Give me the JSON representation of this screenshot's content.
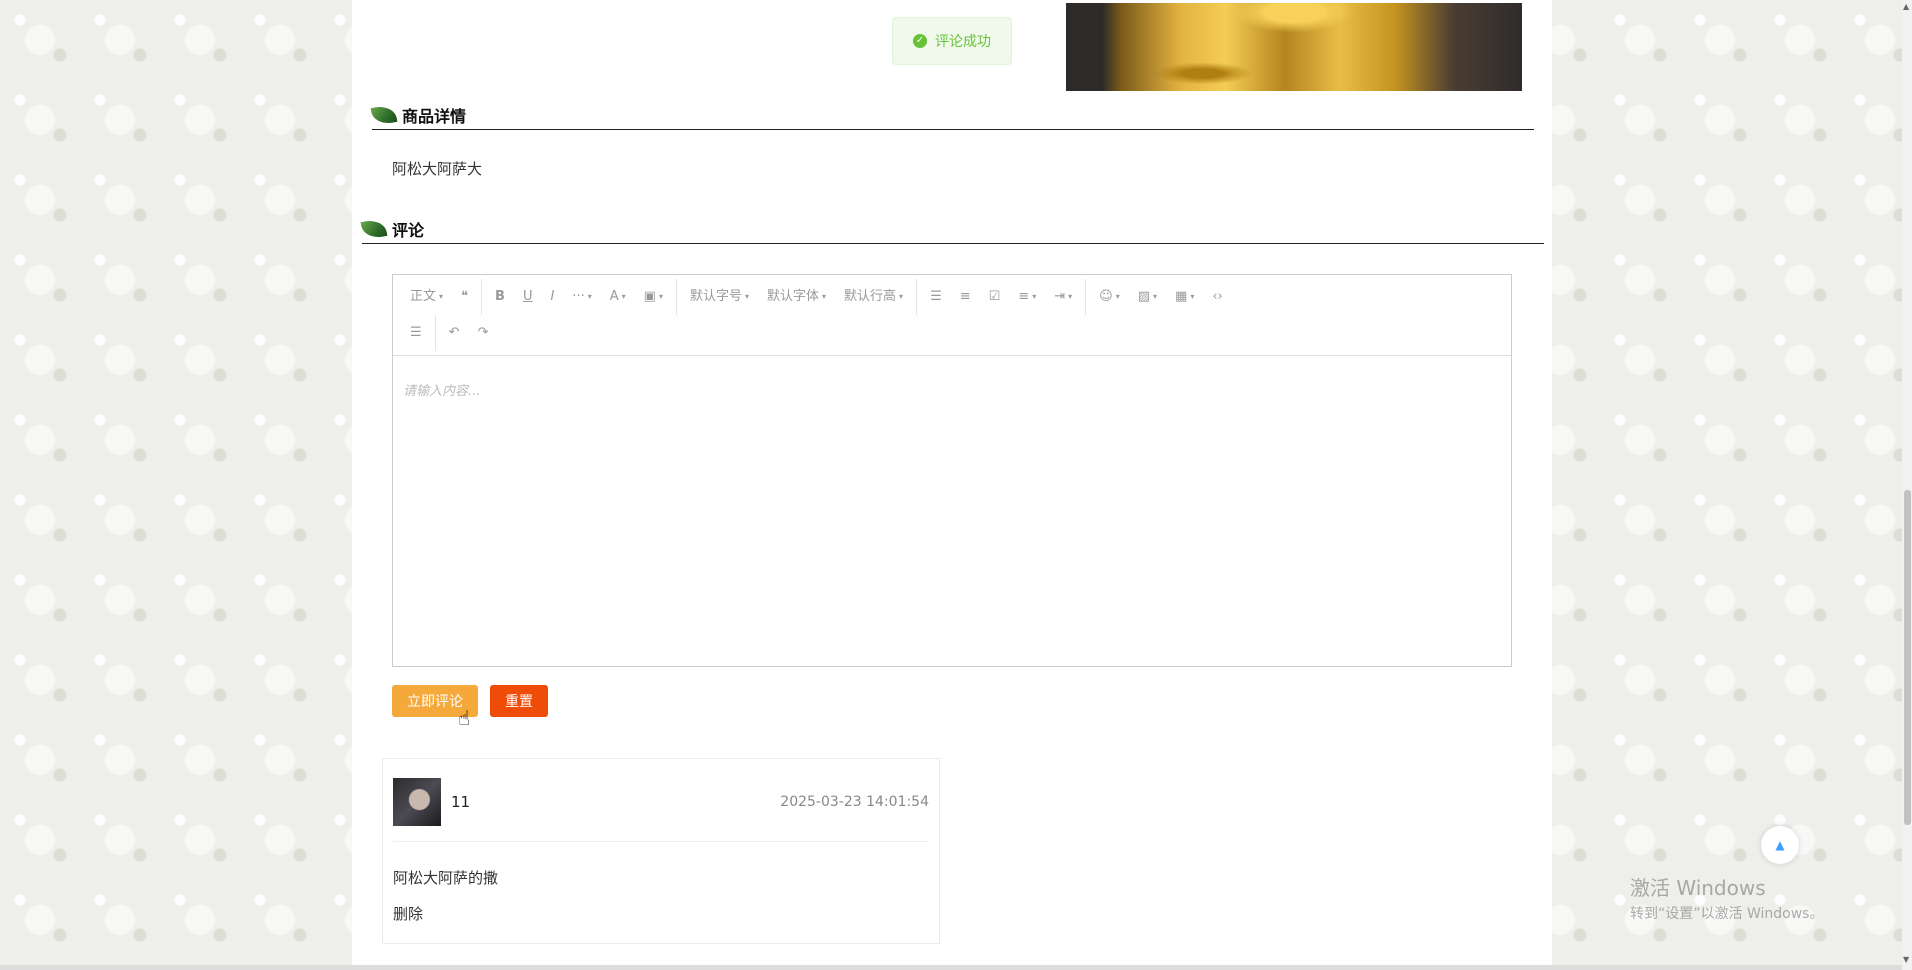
{
  "toast": {
    "message": "评论成功"
  },
  "sections": {
    "detail_title": "商品详情",
    "detail_text": "阿松大阿萨大",
    "comment_title": "评论"
  },
  "editor": {
    "toolbar_row1": [
      {
        "name": "paragraph-select",
        "label": "正文",
        "caret": true
      },
      {
        "name": "blockquote-button",
        "icon": "❝"
      },
      {
        "name": "bold-button",
        "icon": "B"
      },
      {
        "name": "underline-button",
        "icon": "U"
      },
      {
        "name": "italic-button",
        "icon": "I"
      },
      {
        "name": "more-button",
        "icon": "···",
        "caret": true
      },
      {
        "name": "font-color-button",
        "icon": "A",
        "caret": true
      },
      {
        "name": "bg-color-button",
        "icon": "▣",
        "caret": true
      },
      {
        "name": "font-size-select",
        "label": "默认字号",
        "caret": true
      },
      {
        "name": "font-family-select",
        "label": "默认字体",
        "caret": true
      },
      {
        "name": "line-height-select",
        "label": "默认行高",
        "caret": true
      },
      {
        "name": "bullet-list-button",
        "icon": "☰"
      },
      {
        "name": "numbered-list-button",
        "icon": "≡"
      },
      {
        "name": "todo-button",
        "icon": "☑"
      },
      {
        "name": "align-button",
        "icon": "≡",
        "caret": true
      },
      {
        "name": "indent-button",
        "icon": "⇥",
        "caret": true
      },
      {
        "name": "emoji-button",
        "icon": "☺",
        "caret": true
      },
      {
        "name": "image-button",
        "icon": "▨",
        "caret": true
      },
      {
        "name": "table-button",
        "icon": "▦",
        "caret": true
      },
      {
        "name": "code-button",
        "icon": "‹›"
      }
    ],
    "toolbar_row2": [
      {
        "name": "divider-button",
        "icon": "☰"
      },
      {
        "name": "undo-button",
        "icon": "↶"
      },
      {
        "name": "redo-button",
        "icon": "↷"
      }
    ],
    "placeholder": "请输入内容..."
  },
  "buttons": {
    "submit": "立即评论",
    "reset": "重置"
  },
  "comment": {
    "username": "11",
    "time": "2025-03-23 14:01:54",
    "text": "阿松大阿萨的撒",
    "delete": "删除"
  },
  "watermark": {
    "title": "激活 Windows",
    "subtitle": "转到“设置”以激活 Windows。"
  },
  "colors": {
    "submit": "#f6a93b",
    "reset": "#ef4c0a",
    "toast": "#67c23a"
  }
}
